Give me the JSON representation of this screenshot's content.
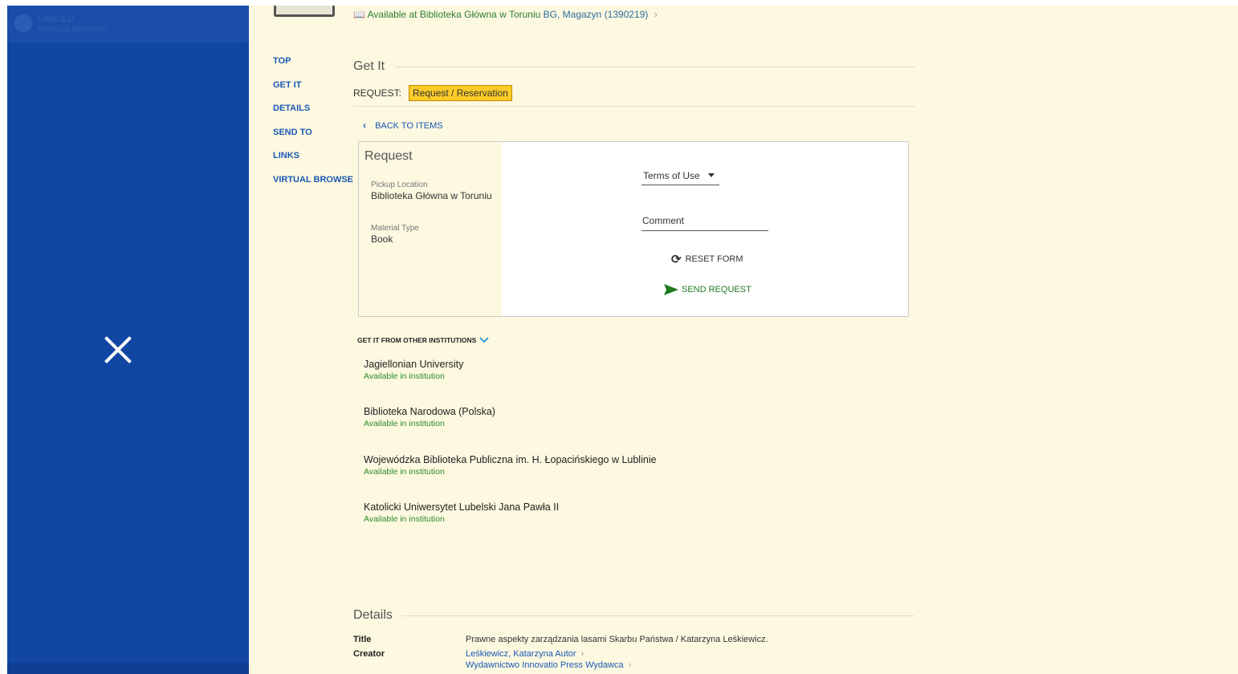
{
  "top": {
    "availability": "Available at Biblioteka Główna w Toruniu",
    "location": "BG, Magazyn (1390219)"
  },
  "overlay": {
    "logo_title": "UMK.EU",
    "logo_sub": "KATALOG ZBIORÓW"
  },
  "nav": [
    "TOP",
    "GET IT",
    "DETAILS",
    "SEND TO",
    "LINKS",
    "VIRTUAL BROWSE"
  ],
  "getit": {
    "title": "Get It",
    "request_label": "REQUEST:",
    "request_button": "Request / Reservation",
    "back_label": "BACK TO ITEMS"
  },
  "request": {
    "title": "Request",
    "pickup_label": "Pickup Location",
    "pickup_value": "Biblioteka Główna w Toruniu",
    "material_label": "Material Type",
    "material_value": "Book",
    "terms_label": "Terms of Use",
    "comment_label": "Comment",
    "reset_label": "RESET FORM",
    "send_label": "SEND REQUEST"
  },
  "other": {
    "title": "GET IT FROM OTHER INSTITUTIONS",
    "institutions": [
      {
        "name": "Jagiellonian University",
        "status": "Available in institution"
      },
      {
        "name": "Biblioteka Narodowa (Polska)",
        "status": "Available in institution"
      },
      {
        "name": "Wojewódzka Biblioteka Publiczna im. H. Łopacińskiego w Lublinie",
        "status": "Available in institution"
      },
      {
        "name": "Katolicki Uniwersytet Lubelski Jana Pawła II",
        "status": "Available in institution"
      }
    ]
  },
  "details": {
    "title": "Details",
    "title_label": "Title",
    "title_value": "Prawne aspekty zarządzania lasami Skarbu Państwa / Katarzyna Leśkiewicz.",
    "creator_label": "Creator",
    "creator_1": "Leśkiewicz, Katarzyna Autor",
    "creator_2": "Wydawnictwo Innovatio Press Wydawca"
  },
  "colors": {
    "overlay_blue": "#1147a3",
    "background": "#fdf8e0",
    "request_button": "#fbcb28",
    "available_green": "#2e8b2e",
    "link_blue": "#1a59b5"
  }
}
